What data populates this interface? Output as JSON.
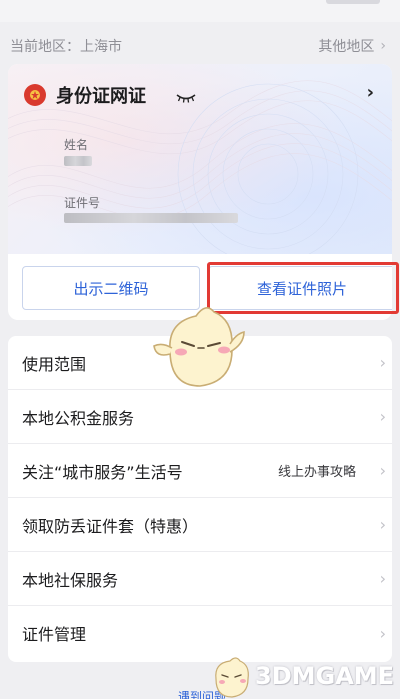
{
  "region": {
    "current": "当前地区：上海市",
    "other": "其他地区"
  },
  "card": {
    "title": "身份证网证",
    "name_label": "姓名",
    "id_label": "证件号",
    "btn_qr": "出示二维码",
    "btn_photo": "查看证件照片"
  },
  "list": [
    {
      "label": "使用范围",
      "hint": ""
    },
    {
      "label": "本地公积金服务",
      "hint": ""
    },
    {
      "label": "关注“城市服务”生活号",
      "hint": "线上办事攻略"
    },
    {
      "label": "领取防丢证件套（特惠）",
      "hint": ""
    },
    {
      "label": "本地社保服务",
      "hint": ""
    },
    {
      "label": "证件管理",
      "hint": ""
    }
  ],
  "bottom_link": "遇到问题",
  "watermark": "3DMGAME",
  "colors": {
    "accent": "#2e63d8",
    "highlight": "#e23a34",
    "emblem": "#d93a2e",
    "background": "#efeff2"
  },
  "icons": [
    "national-emblem-icon",
    "eye-closed-icon",
    "chevron-right-icon",
    "mascot-icon"
  ]
}
